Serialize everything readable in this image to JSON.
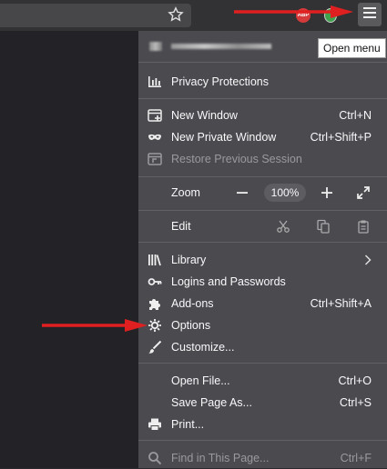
{
  "tooltip": "Open menu",
  "extensions": {
    "abp_label": "ABP"
  },
  "account": {
    "name_blurred": ""
  },
  "menu": {
    "privacy": "Privacy Protections",
    "new_window": {
      "label": "New Window",
      "shortcut": "Ctrl+N"
    },
    "new_private": {
      "label": "New Private Window",
      "shortcut": "Ctrl+Shift+P"
    },
    "restore": {
      "label": "Restore Previous Session"
    },
    "zoom": {
      "label": "Zoom",
      "value": "100%"
    },
    "edit": {
      "label": "Edit"
    },
    "library": {
      "label": "Library"
    },
    "logins": {
      "label": "Logins and Passwords"
    },
    "addons": {
      "label": "Add-ons",
      "shortcut": "Ctrl+Shift+A"
    },
    "options": {
      "label": "Options"
    },
    "customize": {
      "label": "Customize..."
    },
    "open_file": {
      "label": "Open File...",
      "shortcut": "Ctrl+O"
    },
    "save_page": {
      "label": "Save Page As...",
      "shortcut": "Ctrl+S"
    },
    "print": {
      "label": "Print..."
    },
    "find": {
      "label": "Find in This Page...",
      "shortcut": "Ctrl+F"
    }
  },
  "icons": [
    "star-icon",
    "hamburger-icon",
    "chart-icon",
    "new-window-icon",
    "mask-icon",
    "restore-icon",
    "minus-icon",
    "plus-icon",
    "fullscreen-icon",
    "scissors-icon",
    "copy-icon",
    "paste-icon",
    "library-icon",
    "key-icon",
    "puzzle-icon",
    "gear-icon",
    "brush-icon",
    "printer-icon",
    "search-icon",
    "chevron-right-icon"
  ],
  "colors": {
    "annotation_arrow": "#e02020",
    "panel_bg": "#4a4a4f",
    "toolbar_bg": "#323234"
  }
}
